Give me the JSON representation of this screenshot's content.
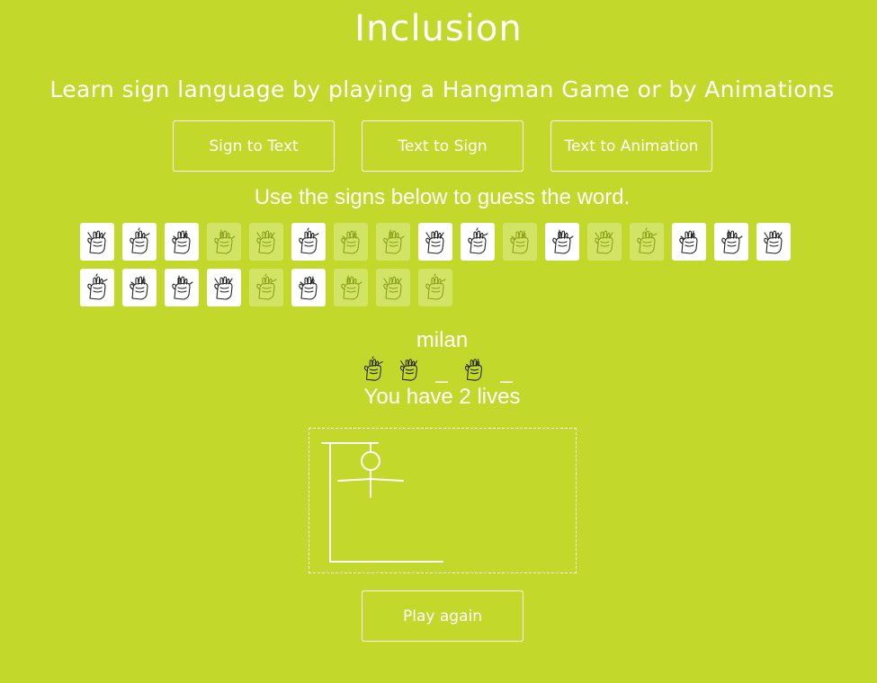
{
  "app": {
    "title": "Inclusion",
    "subtitle": "Learn sign language by playing a Hangman Game or by Animations"
  },
  "nav": {
    "buttons": [
      {
        "label": "Sign to Text"
      },
      {
        "label": "Text to Sign"
      },
      {
        "label": "Text to Animation"
      }
    ]
  },
  "game": {
    "instructions": "Use the signs below to guess the word.",
    "hint": "milan",
    "lives_text": "You have 2 lives",
    "play_again_label": "Play again",
    "blank_char": "_",
    "word_slots": [
      {
        "state": "revealed",
        "icon": "hand-sign-m-icon"
      },
      {
        "state": "revealed",
        "icon": "hand-sign-i-icon"
      },
      {
        "state": "hidden"
      },
      {
        "state": "revealed",
        "icon": "hand-sign-a-icon"
      },
      {
        "state": "hidden"
      }
    ],
    "letter_rows": [
      [
        {
          "icon": "hand-sign-y-icon",
          "used": false
        },
        {
          "icon": "hand-sign-c-icon",
          "used": false
        },
        {
          "icon": "hand-sign-g-icon",
          "used": false
        },
        {
          "icon": "hand-sign-b-icon",
          "used": true
        },
        {
          "icon": "hand-sign-e-icon",
          "used": true
        },
        {
          "icon": "hand-sign-k-icon",
          "used": false
        },
        {
          "icon": "hand-sign-p-icon",
          "used": true
        },
        {
          "icon": "hand-sign-h-icon",
          "used": true
        },
        {
          "icon": "hand-sign-q-icon",
          "used": false
        },
        {
          "icon": "hand-sign-v-icon",
          "used": false
        },
        {
          "icon": "hand-sign-m-icon",
          "used": true
        },
        {
          "icon": "hand-sign-o-icon",
          "used": false
        },
        {
          "icon": "hand-sign-s-icon",
          "used": true
        },
        {
          "icon": "hand-sign-a-icon",
          "used": true
        },
        {
          "icon": "hand-sign-w-icon",
          "used": false
        },
        {
          "icon": "hand-sign-x-icon",
          "used": false
        },
        {
          "icon": "hand-sign-r-icon",
          "used": false
        }
      ],
      [
        {
          "icon": "hand-sign-z-icon",
          "used": false
        },
        {
          "icon": "hand-sign-t-icon",
          "used": false
        },
        {
          "icon": "hand-sign-f-icon",
          "used": false
        },
        {
          "icon": "hand-sign-d-icon",
          "used": false
        },
        {
          "icon": "hand-sign-n-icon",
          "used": true
        },
        {
          "icon": "hand-sign-l-icon",
          "used": false
        },
        {
          "icon": "hand-sign-i-icon",
          "used": true
        },
        {
          "icon": "hand-sign-j-icon",
          "used": true
        },
        {
          "icon": "hand-sign-u-icon",
          "used": true
        }
      ]
    ]
  },
  "colors": {
    "background": "#c2d82b",
    "foreground": "#ffffff",
    "used_tile": "rgba(255,255,255,0.28)"
  }
}
